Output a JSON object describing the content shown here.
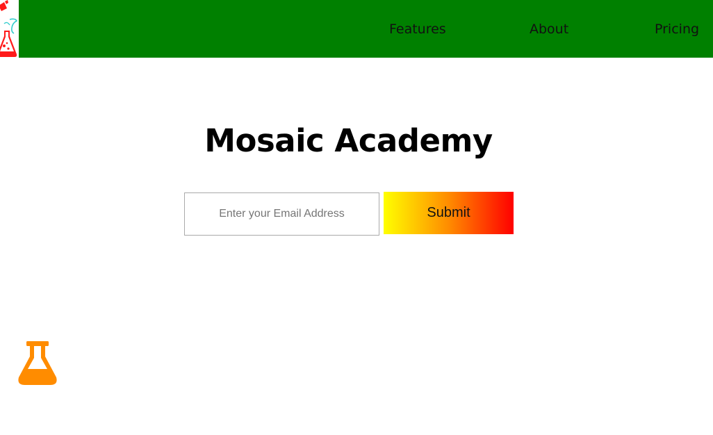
{
  "header": {
    "background": "#008000",
    "logo_icon": "flask-logo-icon",
    "nav": [
      {
        "label": "Features"
      },
      {
        "label": "About"
      },
      {
        "label": "Pricing"
      }
    ]
  },
  "hero": {
    "title": "Mosaic Academy",
    "email_placeholder": "Enter your Email Address",
    "email_value": "",
    "submit_label": "Submit",
    "submit_gradient": [
      "#ffff00",
      "#ff8c00",
      "#ff0000"
    ]
  },
  "decor": {
    "flask_icon": "flask-icon",
    "flask_color": "#ff8c00"
  }
}
